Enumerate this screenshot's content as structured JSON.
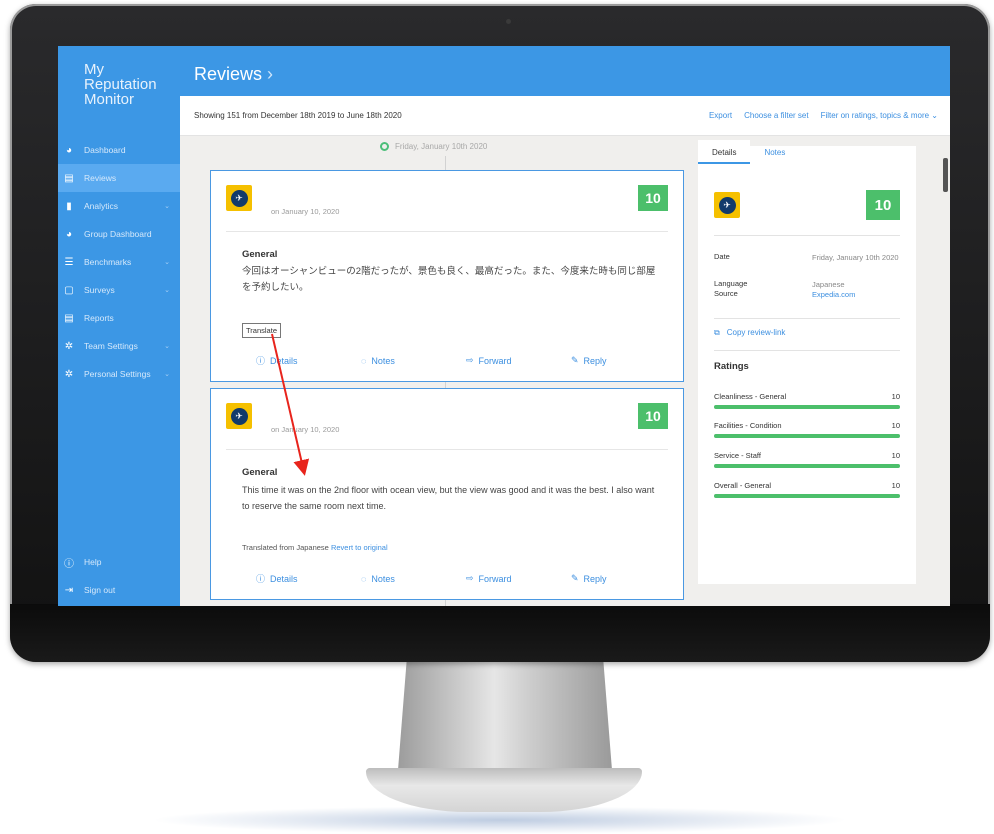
{
  "app": {
    "logo_lines": [
      "My",
      "Reputation",
      "Monitor"
    ],
    "page_title": "Reviews",
    "title_chevron": "›"
  },
  "sidebar": {
    "items": [
      {
        "label": "Dashboard",
        "icon": "dashboard-icon",
        "glyph": "◕",
        "chevron": ""
      },
      {
        "label": "Reviews",
        "icon": "reviews-icon",
        "glyph": "▤",
        "chevron": "",
        "active": true
      },
      {
        "label": "Analytics",
        "icon": "analytics-icon",
        "glyph": "▮",
        "chevron": "⌄"
      },
      {
        "label": "Group Dashboard",
        "icon": "group-dashboard-icon",
        "glyph": "◕",
        "chevron": ""
      },
      {
        "label": "Benchmarks",
        "icon": "benchmarks-icon",
        "glyph": "☰",
        "chevron": "⌄"
      },
      {
        "label": "Surveys",
        "icon": "surveys-icon",
        "glyph": "▢",
        "chevron": "⌄"
      },
      {
        "label": "Reports",
        "icon": "reports-icon",
        "glyph": "▤",
        "chevron": ""
      },
      {
        "label": "Team Settings",
        "icon": "team-settings-icon",
        "glyph": "✲",
        "chevron": "⌄"
      },
      {
        "label": "Personal Settings",
        "icon": "personal-settings-icon",
        "glyph": "✲",
        "chevron": "⌄"
      }
    ],
    "bottom": [
      {
        "label": "Help",
        "icon": "help-icon",
        "glyph": "ⓘ"
      },
      {
        "label": "Sign out",
        "icon": "sign-out-icon",
        "glyph": "⇥"
      }
    ]
  },
  "subbar": {
    "showing": "Showing 151 from December 18th 2019 to June 18th 2020",
    "export": "Export",
    "filter_set": "Choose a filter set",
    "filter_ratings": "Filter on ratings, topics & more",
    "filter_chevron": "⌄"
  },
  "timeline": {
    "date_label": "Friday, January 10th 2020"
  },
  "reviews": [
    {
      "date": "on January 10, 2020",
      "score": "10",
      "heading": "General",
      "body": "今回はオーシャンビューの2階だったが、景色も良く、最高だった。また、今度来た時も同じ部屋を予約したい。",
      "translate_label": "Translate"
    },
    {
      "date": "on January 10, 2020",
      "score": "10",
      "heading": "General",
      "body": "This time it was on the 2nd floor with ocean view, but the view was good and it was the best. I also want to reserve the same room next time.",
      "translated_from": "Translated from Japanese",
      "revert": "Revert to original"
    }
  ],
  "review_actions": {
    "details": "Details",
    "notes": "Notes",
    "forward": "Forward",
    "reply": "Reply"
  },
  "details_panel": {
    "tab_details": "Details",
    "tab_notes": "Notes",
    "score": "10",
    "date_label": "Date",
    "date_value": "Friday, January 10th 2020",
    "language_label": "Language",
    "language_value": "Japanese",
    "source_label": "Source",
    "source_value": "Expedia.com",
    "copy_link": "Copy review-link",
    "ratings_title": "Ratings",
    "ratings": [
      {
        "label": "Cleanliness - General",
        "value": "10",
        "fraction": 1.0
      },
      {
        "label": "Facilities - Condition",
        "value": "10",
        "fraction": 1.0
      },
      {
        "label": "Service - Staff",
        "value": "10",
        "fraction": 1.0
      },
      {
        "label": "Overall - General",
        "value": "10",
        "fraction": 1.0
      }
    ]
  },
  "colors": {
    "brand_blue": "#3c97e5",
    "score_green": "#4cbf6b",
    "annotation_red": "#e8241c",
    "expedia_yellow": "#f5c000"
  }
}
